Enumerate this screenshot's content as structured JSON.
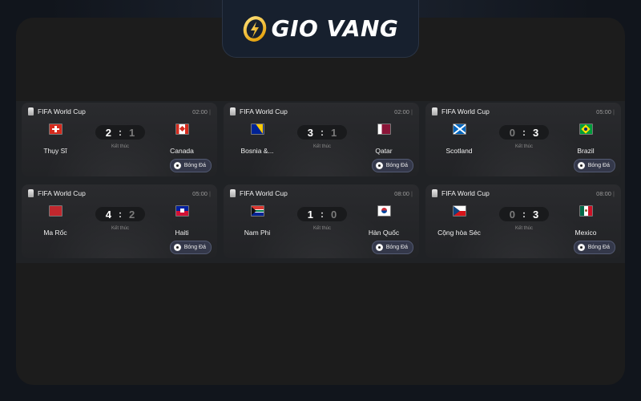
{
  "brand": {
    "logo_text": "GIO VANG"
  },
  "matches": [
    {
      "competition": "FIFA World Cup",
      "time": "02:00",
      "home": {
        "name": "Thụy Sĩ",
        "flag": "switzerland-flag-icon",
        "score": "2"
      },
      "away": {
        "name": "Canada",
        "flag": "canada-flag-icon",
        "score": "1"
      },
      "status": "Kết thúc",
      "sport": "Bóng Đá"
    },
    {
      "competition": "FIFA World Cup",
      "time": "02:00",
      "home": {
        "name": "Bosnia &...",
        "flag": "bosnia-flag-icon",
        "score": "3"
      },
      "away": {
        "name": "Qatar",
        "flag": "qatar-flag-icon",
        "score": "1"
      },
      "status": "Kết thúc",
      "sport": "Bóng Đá"
    },
    {
      "competition": "FIFA World Cup",
      "time": "05:00",
      "home": {
        "name": "Scotland",
        "flag": "scotland-flag-icon",
        "score": "0"
      },
      "away": {
        "name": "Brazil",
        "flag": "brazil-flag-icon",
        "score": "3"
      },
      "status": "Kết thúc",
      "sport": "Bóng Đá"
    },
    {
      "competition": "FIFA World Cup",
      "time": "05:00",
      "home": {
        "name": "Ma Rốc",
        "flag": "morocco-flag-icon",
        "score": "4"
      },
      "away": {
        "name": "Haiti",
        "flag": "haiti-flag-icon",
        "score": "2"
      },
      "status": "Kết thúc",
      "sport": "Bóng Đá"
    },
    {
      "competition": "FIFA World Cup",
      "time": "08:00",
      "home": {
        "name": "Nam Phi",
        "flag": "south-africa-flag-icon",
        "score": "1"
      },
      "away": {
        "name": "Hàn Quốc",
        "flag": "south-korea-flag-icon",
        "score": "0"
      },
      "status": "Kết thúc",
      "sport": "Bóng Đá"
    },
    {
      "competition": "FIFA World Cup",
      "time": "08:00",
      "home": {
        "name": "Cộng hòa Séc",
        "flag": "czech-flag-icon",
        "score": "0"
      },
      "away": {
        "name": "Mexico",
        "flag": "mexico-flag-icon",
        "score": "3"
      },
      "status": "Kết thúc",
      "sport": "Bóng Đá"
    }
  ],
  "colors": {
    "accent_gold": "#f5b400",
    "card_bg": "#26272a",
    "panel_bg": "#1c1c1c",
    "sport_badge_bg": "#34384a"
  }
}
